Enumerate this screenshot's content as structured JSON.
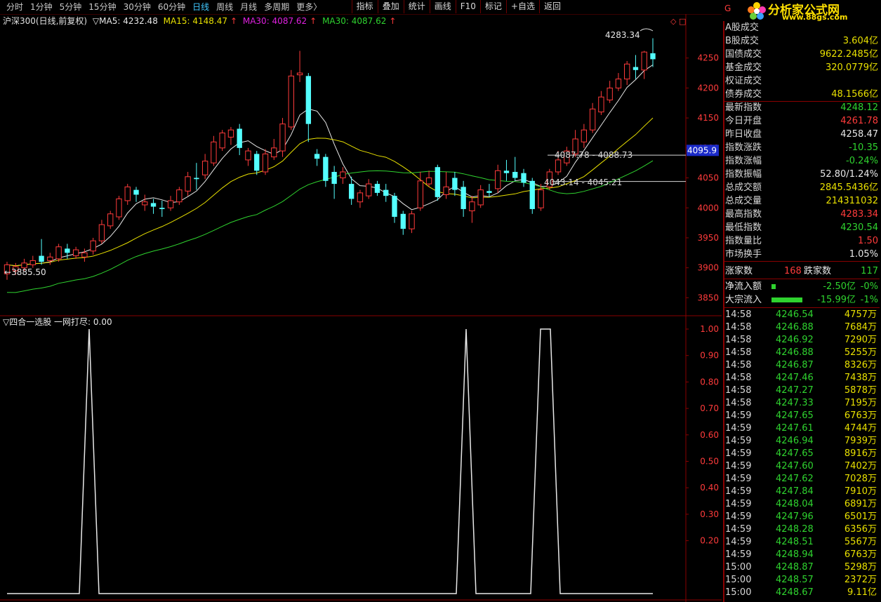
{
  "toolbar": {
    "periods": [
      "分时",
      "1分钟",
      "5分钟",
      "15分钟",
      "30分钟",
      "60分钟",
      "日线",
      "周线",
      "月线",
      "多周期",
      "更多〉"
    ],
    "active_period": "日线",
    "buttons": [
      "指标",
      "叠加",
      "统计",
      "画线",
      "F10",
      "标记",
      "+自选",
      "返回"
    ]
  },
  "info": {
    "security": "沪深300(日线,前复权)",
    "ma5_label": "▽MA5: 4232.48",
    "ma15_label": "MA15: 4148.47",
    "ma30a_label": "MA30: 4087.62",
    "ma30b_label": "MA30: 4087.62",
    "colors": {
      "ma5": "#e8e8e8",
      "ma15": "#e8e000",
      "ma30a": "#e020e0",
      "ma30b": "#2fd32f",
      "up": "#ff3b3b",
      "down": "#54ffff"
    }
  },
  "price_axis": [
    "4250",
    "4200",
    "4150",
    "4100",
    "4050",
    "4000",
    "3950",
    "3900",
    "3850"
  ],
  "price_marker": "4095.9",
  "annotations": {
    "high": "4283.34",
    "low": "3885.50",
    "range1": "4087.78 - 4088.73",
    "range2": "4043.14 - 4045.21"
  },
  "indicator": {
    "title": "▽四合一选股  一网打尽: 0.00",
    "axis": [
      "1.00",
      "0.90",
      "0.80",
      "0.70",
      "0.60",
      "0.50",
      "0.40",
      "0.30",
      "0.20"
    ]
  },
  "chart_data": {
    "type": "candlestick",
    "ylim": [
      3820,
      4300
    ],
    "candles": [
      [
        3890,
        3905,
        3880,
        3910
      ],
      [
        3895,
        3902,
        3888,
        3908
      ],
      [
        3900,
        3908,
        3895,
        3915
      ],
      [
        3905,
        3912,
        3900,
        3920
      ],
      [
        3920,
        3910,
        3905,
        3948
      ],
      [
        3912,
        3918,
        3905,
        3925
      ],
      [
        3915,
        3935,
        3910,
        3940
      ],
      [
        3932,
        3925,
        3915,
        3940
      ],
      [
        3920,
        3930,
        3915,
        3935
      ],
      [
        3918,
        3925,
        3910,
        3932
      ],
      [
        3928,
        3945,
        3922,
        3950
      ],
      [
        3945,
        3972,
        3940,
        3980
      ],
      [
        3970,
        3990,
        3965,
        3995
      ],
      [
        3985,
        4015,
        3980,
        4020
      ],
      [
        4012,
        4035,
        4005,
        4040
      ],
      [
        4030,
        4022,
        4010,
        4035
      ],
      [
        4005,
        4010,
        3995,
        4022
      ],
      [
        4008,
        4002,
        3990,
        4015
      ],
      [
        4000,
        3998,
        3985,
        4012
      ],
      [
        4000,
        4012,
        3995,
        4020
      ],
      [
        4010,
        4030,
        4005,
        4035
      ],
      [
        4028,
        4052,
        4020,
        4060
      ],
      [
        4050,
        4048,
        4030,
        4075
      ],
      [
        4055,
        4078,
        4048,
        4090
      ],
      [
        4075,
        4110,
        4070,
        4120
      ],
      [
        4100,
        4125,
        4095,
        4130
      ],
      [
        4118,
        4130,
        4105,
        4135
      ],
      [
        4132,
        4100,
        4088,
        4140
      ],
      [
        4080,
        4095,
        4070,
        4100
      ],
      [
        4090,
        4062,
        4055,
        4095
      ],
      [
        4060,
        4090,
        4055,
        4098
      ],
      [
        4085,
        4100,
        4080,
        4115
      ],
      [
        4095,
        4140,
        4085,
        4150
      ],
      [
        4135,
        4220,
        4130,
        4230
      ],
      [
        4222,
        4225,
        4210,
        4262
      ],
      [
        4220,
        4140,
        4110,
        4225
      ],
      [
        4090,
        4082,
        4070,
        4098
      ],
      [
        4085,
        4045,
        4035,
        4090
      ],
      [
        4060,
        4040,
        4015,
        4070
      ],
      [
        4050,
        4060,
        4040,
        4068
      ],
      [
        4040,
        4015,
        4005,
        4052
      ],
      [
        4010,
        4025,
        4000,
        4030
      ],
      [
        4020,
        4040,
        4015,
        4048
      ],
      [
        4040,
        4025,
        4020,
        4045
      ],
      [
        4030,
        4020,
        4010,
        4040
      ],
      [
        4020,
        3985,
        3975,
        4025
      ],
      [
        3990,
        3965,
        3955,
        3995
      ],
      [
        3965,
        3990,
        3958,
        3995
      ],
      [
        4000,
        4045,
        3995,
        4060
      ],
      [
        4040,
        4050,
        4035,
        4062
      ],
      [
        4068,
        4018,
        4012,
        4072
      ],
      [
        4022,
        4035,
        4015,
        4060
      ],
      [
        4050,
        4030,
        4020,
        4060
      ],
      [
        4035,
        3998,
        3985,
        4045
      ],
      [
        3995,
        4010,
        3975,
        4020
      ],
      [
        4005,
        4030,
        4000,
        4038
      ],
      [
        4028,
        4025,
        4018,
        4040
      ],
      [
        4032,
        4062,
        4025,
        4072
      ],
      [
        4062,
        4058,
        4045,
        4080
      ],
      [
        4060,
        4050,
        4045,
        4085
      ],
      [
        4058,
        4042,
        4035,
        4065
      ],
      [
        4045,
        3998,
        3990,
        4050
      ],
      [
        4000,
        4030,
        3995,
        4040
      ],
      [
        4035,
        4060,
        4030,
        4065
      ],
      [
        4060,
        4080,
        4055,
        4095
      ],
      [
        4075,
        4095,
        4070,
        4102
      ],
      [
        4090,
        4115,
        4085,
        4130
      ],
      [
        4110,
        4130,
        4100,
        4140
      ],
      [
        4130,
        4165,
        4125,
        4175
      ],
      [
        4160,
        4185,
        4155,
        4195
      ],
      [
        4180,
        4200,
        4175,
        4212
      ],
      [
        4200,
        4215,
        4195,
        4225
      ],
      [
        4215,
        4240,
        4205,
        4245
      ],
      [
        4235,
        4230,
        4215,
        4255
      ],
      [
        4230,
        4260,
        4215,
        4262
      ],
      [
        4258,
        4248,
        4235,
        4283
      ]
    ],
    "spikes_x_fraction_of_series": [
      0.13,
      0.67,
      0.78
    ],
    "indicator_values": "0 or 1"
  },
  "stats": [
    {
      "label": "A股成交",
      "value": "",
      "color": "white"
    },
    {
      "label": "B股成交",
      "value": "3.604亿",
      "color": "yellow"
    },
    {
      "label": "国债成交",
      "value": "9622.2485亿",
      "color": "yellow"
    },
    {
      "label": "基金成交",
      "value": "320.0779亿",
      "color": "yellow"
    },
    {
      "label": "权证成交",
      "value": "",
      "color": "yellow"
    },
    {
      "label": "债券成交",
      "value": "48.1566亿",
      "color": "yellow"
    },
    {
      "label": "最新指数",
      "value": "4248.12",
      "color": "green"
    },
    {
      "label": "今日开盘",
      "value": "4261.78",
      "color": "red"
    },
    {
      "label": "昨日收盘",
      "value": "4258.47",
      "color": "white"
    },
    {
      "label": "指数涨跌",
      "value": "-10.35",
      "color": "green"
    },
    {
      "label": "指数涨幅",
      "value": "-0.24%",
      "color": "green"
    },
    {
      "label": "指数振幅",
      "value": "52.80/1.24%",
      "color": "white"
    },
    {
      "label": "总成交额",
      "value": "2845.5436亿",
      "color": "yellow"
    },
    {
      "label": "总成交量",
      "value": "214311032",
      "color": "yellow"
    },
    {
      "label": "最高指数",
      "value": "4283.34",
      "color": "red"
    },
    {
      "label": "最低指数",
      "value": "4230.54",
      "color": "green"
    },
    {
      "label": "指数量比",
      "value": "1.50",
      "color": "red"
    },
    {
      "label": "市场换手",
      "value": "1.05%",
      "color": "white"
    }
  ],
  "updown": {
    "up_label": "涨家数",
    "up": "168",
    "down_label": "跌家数",
    "down": "117"
  },
  "flows": [
    {
      "label": "净流入额",
      "value": "-2.50亿",
      "pct": "-0%"
    },
    {
      "label": "大宗流入",
      "value": "-15.99亿",
      "pct": "-1%"
    }
  ],
  "logo": {
    "text": "分析家公式网",
    "url": "www.88gs.com"
  },
  "ticks": [
    [
      "14:58",
      "4246.54",
      "4757万"
    ],
    [
      "14:58",
      "4246.88",
      "7684万"
    ],
    [
      "14:58",
      "4246.92",
      "7290万"
    ],
    [
      "14:58",
      "4246.88",
      "5255万"
    ],
    [
      "14:58",
      "4246.87",
      "8326万"
    ],
    [
      "14:58",
      "4247.46",
      "7438万"
    ],
    [
      "14:58",
      "4247.27",
      "5878万"
    ],
    [
      "14:58",
      "4247.33",
      "7195万"
    ],
    [
      "14:59",
      "4247.65",
      "6763万"
    ],
    [
      "14:59",
      "4247.61",
      "4744万"
    ],
    [
      "14:59",
      "4246.94",
      "7939万"
    ],
    [
      "14:59",
      "4247.65",
      "8916万"
    ],
    [
      "14:59",
      "4247.60",
      "7402万"
    ],
    [
      "14:59",
      "4247.62",
      "7028万"
    ],
    [
      "14:59",
      "4247.84",
      "7910万"
    ],
    [
      "14:59",
      "4248.04",
      "6891万"
    ],
    [
      "14:59",
      "4247.96",
      "6501万"
    ],
    [
      "14:59",
      "4248.28",
      "6356万"
    ],
    [
      "14:59",
      "4248.51",
      "5567万"
    ],
    [
      "14:59",
      "4248.94",
      "6763万"
    ],
    [
      "15:00",
      "4248.87",
      "5298万"
    ],
    [
      "15:00",
      "4248.57",
      "2372万"
    ],
    [
      "15:00",
      "4248.67",
      "9.11亿"
    ]
  ]
}
